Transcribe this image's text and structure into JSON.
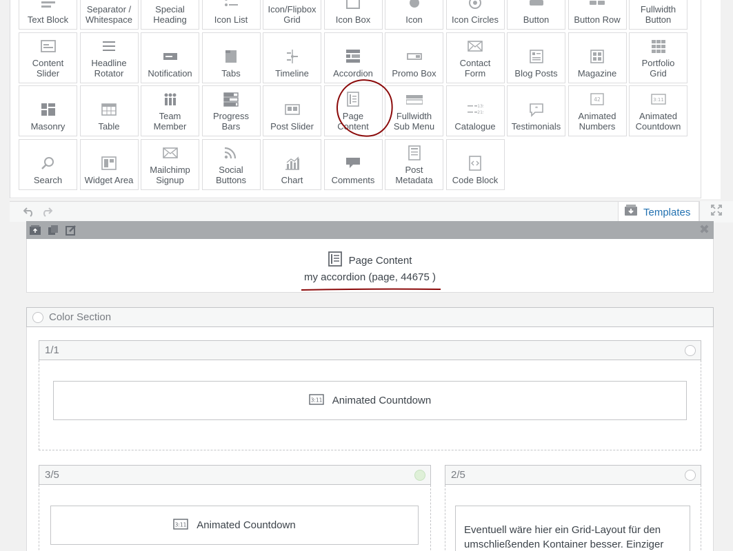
{
  "palette": {
    "tiles": [
      {
        "label": "Text Block",
        "icon": "text-block-icon"
      },
      {
        "label": "Separator /\nWhitespace",
        "icon": "separator-icon"
      },
      {
        "label": "Special\nHeading",
        "icon": "special-heading-icon"
      },
      {
        "label": "Icon List",
        "icon": "icon-list-icon"
      },
      {
        "label": "Icon/Flipbox\nGrid",
        "icon": "flipbox-grid-icon"
      },
      {
        "label": "Icon Box",
        "icon": "icon-box-icon"
      },
      {
        "label": "Icon",
        "icon": "icon-icon"
      },
      {
        "label": "Icon Circles",
        "icon": "icon-circles-icon"
      },
      {
        "label": "Button",
        "icon": "button-icon"
      },
      {
        "label": "Button Row",
        "icon": "button-row-icon"
      },
      {
        "label": "Fullwidth\nButton",
        "icon": "fullwidth-button-icon"
      },
      {
        "label": "Content\nSlider",
        "icon": "content-slider-icon"
      },
      {
        "label": "Headline\nRotator",
        "icon": "headline-rotator-icon"
      },
      {
        "label": "Notification",
        "icon": "notification-icon"
      },
      {
        "label": "Tabs",
        "icon": "tabs-icon"
      },
      {
        "label": "Timeline",
        "icon": "timeline-icon"
      },
      {
        "label": "Accordion",
        "icon": "accordion-icon"
      },
      {
        "label": "Promo Box",
        "icon": "promo-box-icon"
      },
      {
        "label": "Contact\nForm",
        "icon": "envelope-icon"
      },
      {
        "label": "Blog Posts",
        "icon": "blog-posts-icon"
      },
      {
        "label": "Magazine",
        "icon": "magazine-icon"
      },
      {
        "label": "Portfolio\nGrid",
        "icon": "portfolio-grid-icon"
      },
      {
        "label": "Masonry",
        "icon": "masonry-icon"
      },
      {
        "label": "Table",
        "icon": "table-icon"
      },
      {
        "label": "Team\nMember",
        "icon": "team-member-icon"
      },
      {
        "label": "Progress\nBars",
        "icon": "progress-bars-icon"
      },
      {
        "label": "Post Slider",
        "icon": "post-slider-icon"
      },
      {
        "label": "Page\nContent",
        "icon": "page-content-icon"
      },
      {
        "label": "Fullwidth\nSub Menu",
        "icon": "fullwidth-submenu-icon"
      },
      {
        "label": "Catalogue",
        "icon": "catalogue-icon"
      },
      {
        "label": "Testimonials",
        "icon": "testimonials-icon"
      },
      {
        "label": "Animated\nNumbers",
        "icon": "animated-numbers-icon"
      },
      {
        "label": "Animated\nCountdown",
        "icon": "countdown-icon"
      },
      {
        "label": "Search",
        "icon": "search-icon"
      },
      {
        "label": "Widget Area",
        "icon": "widget-area-icon"
      },
      {
        "label": "Mailchimp\nSignup",
        "icon": "envelope-icon"
      },
      {
        "label": "Social\nButtons",
        "icon": "social-buttons-icon"
      },
      {
        "label": "Chart",
        "icon": "chart-icon"
      },
      {
        "label": "Comments",
        "icon": "comments-icon"
      },
      {
        "label": "Post\nMetadata",
        "icon": "post-metadata-icon"
      },
      {
        "label": "Code Block",
        "icon": "code-block-icon"
      }
    ]
  },
  "toolbar": {
    "templates_label": "Templates"
  },
  "page_content": {
    "title": "Page Content",
    "subtitle": "my accordion (page, 44675 )",
    "close_glyph": "✖"
  },
  "color_section": {
    "label": "Color Section",
    "rows": {
      "full": {
        "label": "1/1",
        "widget": "Animated Countdown"
      },
      "left": {
        "label": "3/5",
        "widget": "Animated Countdown"
      },
      "right": {
        "label": "2/5",
        "text": "Eventuell wäre hier ein Grid-Layout für den umschließenden Kontainer besser. Einziger"
      }
    }
  },
  "colors": {
    "icon_gray": "#8c8f94",
    "link_blue": "#2271b1",
    "annotation_red": "#8b0a0a"
  }
}
